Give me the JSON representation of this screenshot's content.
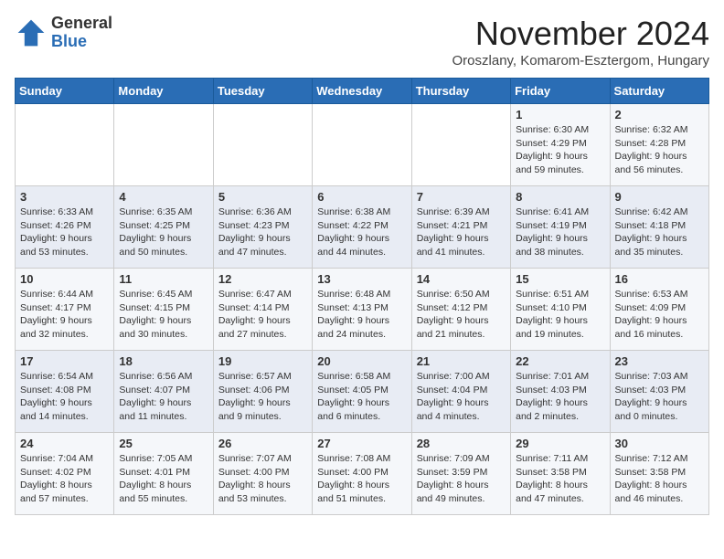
{
  "header": {
    "logo_general": "General",
    "logo_blue": "Blue",
    "month_title": "November 2024",
    "subtitle": "Oroszlany, Komarom-Esztergom, Hungary"
  },
  "days_of_week": [
    "Sunday",
    "Monday",
    "Tuesday",
    "Wednesday",
    "Thursday",
    "Friday",
    "Saturday"
  ],
  "weeks": [
    [
      {
        "day": "",
        "info": ""
      },
      {
        "day": "",
        "info": ""
      },
      {
        "day": "",
        "info": ""
      },
      {
        "day": "",
        "info": ""
      },
      {
        "day": "",
        "info": ""
      },
      {
        "day": "1",
        "info": "Sunrise: 6:30 AM\nSunset: 4:29 PM\nDaylight: 9 hours and 59 minutes."
      },
      {
        "day": "2",
        "info": "Sunrise: 6:32 AM\nSunset: 4:28 PM\nDaylight: 9 hours and 56 minutes."
      }
    ],
    [
      {
        "day": "3",
        "info": "Sunrise: 6:33 AM\nSunset: 4:26 PM\nDaylight: 9 hours and 53 minutes."
      },
      {
        "day": "4",
        "info": "Sunrise: 6:35 AM\nSunset: 4:25 PM\nDaylight: 9 hours and 50 minutes."
      },
      {
        "day": "5",
        "info": "Sunrise: 6:36 AM\nSunset: 4:23 PM\nDaylight: 9 hours and 47 minutes."
      },
      {
        "day": "6",
        "info": "Sunrise: 6:38 AM\nSunset: 4:22 PM\nDaylight: 9 hours and 44 minutes."
      },
      {
        "day": "7",
        "info": "Sunrise: 6:39 AM\nSunset: 4:21 PM\nDaylight: 9 hours and 41 minutes."
      },
      {
        "day": "8",
        "info": "Sunrise: 6:41 AM\nSunset: 4:19 PM\nDaylight: 9 hours and 38 minutes."
      },
      {
        "day": "9",
        "info": "Sunrise: 6:42 AM\nSunset: 4:18 PM\nDaylight: 9 hours and 35 minutes."
      }
    ],
    [
      {
        "day": "10",
        "info": "Sunrise: 6:44 AM\nSunset: 4:17 PM\nDaylight: 9 hours and 32 minutes."
      },
      {
        "day": "11",
        "info": "Sunrise: 6:45 AM\nSunset: 4:15 PM\nDaylight: 9 hours and 30 minutes."
      },
      {
        "day": "12",
        "info": "Sunrise: 6:47 AM\nSunset: 4:14 PM\nDaylight: 9 hours and 27 minutes."
      },
      {
        "day": "13",
        "info": "Sunrise: 6:48 AM\nSunset: 4:13 PM\nDaylight: 9 hours and 24 minutes."
      },
      {
        "day": "14",
        "info": "Sunrise: 6:50 AM\nSunset: 4:12 PM\nDaylight: 9 hours and 21 minutes."
      },
      {
        "day": "15",
        "info": "Sunrise: 6:51 AM\nSunset: 4:10 PM\nDaylight: 9 hours and 19 minutes."
      },
      {
        "day": "16",
        "info": "Sunrise: 6:53 AM\nSunset: 4:09 PM\nDaylight: 9 hours and 16 minutes."
      }
    ],
    [
      {
        "day": "17",
        "info": "Sunrise: 6:54 AM\nSunset: 4:08 PM\nDaylight: 9 hours and 14 minutes."
      },
      {
        "day": "18",
        "info": "Sunrise: 6:56 AM\nSunset: 4:07 PM\nDaylight: 9 hours and 11 minutes."
      },
      {
        "day": "19",
        "info": "Sunrise: 6:57 AM\nSunset: 4:06 PM\nDaylight: 9 hours and 9 minutes."
      },
      {
        "day": "20",
        "info": "Sunrise: 6:58 AM\nSunset: 4:05 PM\nDaylight: 9 hours and 6 minutes."
      },
      {
        "day": "21",
        "info": "Sunrise: 7:00 AM\nSunset: 4:04 PM\nDaylight: 9 hours and 4 minutes."
      },
      {
        "day": "22",
        "info": "Sunrise: 7:01 AM\nSunset: 4:03 PM\nDaylight: 9 hours and 2 minutes."
      },
      {
        "day": "23",
        "info": "Sunrise: 7:03 AM\nSunset: 4:03 PM\nDaylight: 9 hours and 0 minutes."
      }
    ],
    [
      {
        "day": "24",
        "info": "Sunrise: 7:04 AM\nSunset: 4:02 PM\nDaylight: 8 hours and 57 minutes."
      },
      {
        "day": "25",
        "info": "Sunrise: 7:05 AM\nSunset: 4:01 PM\nDaylight: 8 hours and 55 minutes."
      },
      {
        "day": "26",
        "info": "Sunrise: 7:07 AM\nSunset: 4:00 PM\nDaylight: 8 hours and 53 minutes."
      },
      {
        "day": "27",
        "info": "Sunrise: 7:08 AM\nSunset: 4:00 PM\nDaylight: 8 hours and 51 minutes."
      },
      {
        "day": "28",
        "info": "Sunrise: 7:09 AM\nSunset: 3:59 PM\nDaylight: 8 hours and 49 minutes."
      },
      {
        "day": "29",
        "info": "Sunrise: 7:11 AM\nSunset: 3:58 PM\nDaylight: 8 hours and 47 minutes."
      },
      {
        "day": "30",
        "info": "Sunrise: 7:12 AM\nSunset: 3:58 PM\nDaylight: 8 hours and 46 minutes."
      }
    ]
  ]
}
